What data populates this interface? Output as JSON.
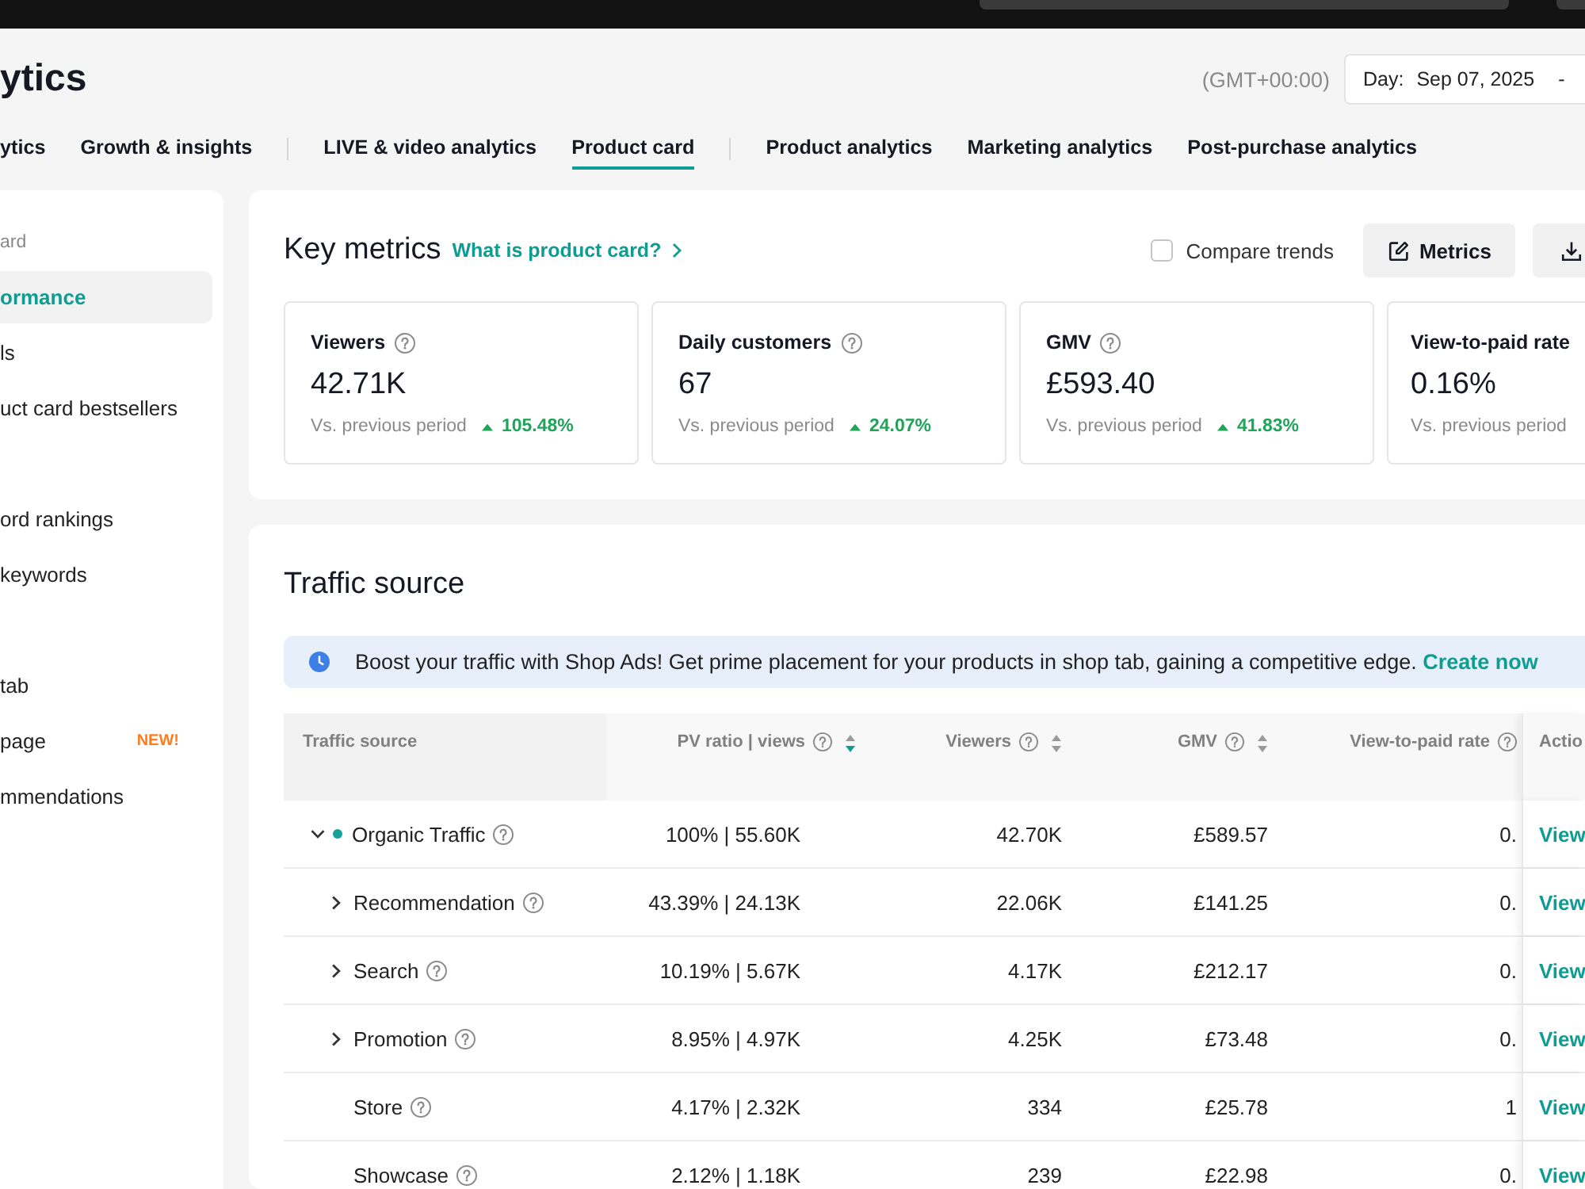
{
  "header": {
    "title": "ytics",
    "timezone": "(GMT+00:00)",
    "date_picker": {
      "label": "Day:",
      "value": "Sep 07, 2025",
      "separator": "-"
    }
  },
  "tab_groups": [
    {
      "tabs": [
        {
          "label": "ytics",
          "selected": false
        },
        {
          "label": "Growth & insights",
          "selected": false
        }
      ]
    },
    {
      "tabs": [
        {
          "label": "LIVE & video analytics",
          "selected": false
        },
        {
          "label": "Product card",
          "selected": true
        }
      ]
    },
    {
      "tabs": [
        {
          "label": "Product analytics",
          "selected": false
        },
        {
          "label": "Marketing analytics",
          "selected": false
        },
        {
          "label": "Post-purchase analytics",
          "selected": false
        }
      ]
    }
  ],
  "sidebar": {
    "groups": [
      {
        "heading": "ard",
        "items": [
          {
            "label": "ormance",
            "selected": true
          },
          {
            "label": "ls",
            "selected": false
          },
          {
            "label": "uct card bestsellers",
            "selected": false
          }
        ]
      },
      {
        "items": [
          {
            "label": "ord rankings",
            "selected": false
          },
          {
            "label": "keywords",
            "selected": false
          }
        ]
      },
      {
        "items": [
          {
            "label": "tab",
            "selected": false
          },
          {
            "label": "page",
            "selected": false,
            "badge": "NEW!"
          },
          {
            "label": "mmendations",
            "selected": false
          }
        ]
      }
    ]
  },
  "key_metrics": {
    "title": "Key metrics",
    "help_link": "What is product card?",
    "compare_trends": {
      "label": "Compare trends",
      "checked": false
    },
    "buttons": [
      {
        "kind": "edit",
        "label": "Metrics"
      },
      {
        "kind": "download"
      }
    ],
    "metrics": [
      {
        "label": "Viewers",
        "help": true,
        "value": "42.71K",
        "comparison": "Vs. previous period",
        "increase": true,
        "change": "105.48%"
      },
      {
        "label": "Daily customers",
        "help": true,
        "value": "67",
        "comparison": "Vs. previous period",
        "increase": true,
        "change": "24.07%"
      },
      {
        "label": "GMV",
        "help": true,
        "value": "£593.40",
        "comparison": "Vs. previous period",
        "increase": true,
        "change": "41.83%"
      },
      {
        "label": "View-to-paid rate",
        "help": false,
        "value": "0.16%",
        "comparison": "Vs. previous period"
      }
    ]
  },
  "traffic_source": {
    "title": "Traffic source",
    "banner": {
      "text": "Boost your traffic with Shop Ads! Get prime placement for your products in shop tab, gaining a competitive edge.",
      "link": "Create now"
    },
    "table": {
      "columns": [
        {
          "label": "Traffic source",
          "help": false
        },
        {
          "label": "PV ratio | views",
          "help": true,
          "sorted": true
        },
        {
          "label": "Viewers",
          "help": true,
          "sorted": false
        },
        {
          "label": "GMV",
          "help": true,
          "sorted": false
        },
        {
          "label": "View-to-paid rate",
          "help": true
        },
        {
          "label": "Actio",
          "help": false
        }
      ],
      "rows": [
        {
          "color": "#14a197",
          "expanded": true,
          "cells": [
            "Organic Traffic",
            "100% | 55.60K",
            "42.70K",
            "£589.57",
            "0.",
            "View"
          ],
          "children": [
            {
              "expanded": false,
              "cells": [
                "Recommendation",
                "43.39% | 24.13K",
                "22.06K",
                "£141.25",
                "0.",
                "View"
              ]
            },
            {
              "expanded": false,
              "cells": [
                "Search",
                "10.19% | 5.67K",
                "4.17K",
                "£212.17",
                "0.",
                "View"
              ]
            },
            {
              "expanded": false,
              "cells": [
                "Promotion",
                "8.95% | 4.97K",
                "4.25K",
                "£73.48",
                "0.",
                "View"
              ]
            },
            {
              "cells": [
                "Store",
                "4.17% | 2.32K",
                "334",
                "£25.78",
                "1",
                "View"
              ]
            },
            {
              "cells": [
                "Showcase",
                "2.12% | 1.18K",
                "239",
                "£22.98",
                "0.",
                "View"
              ]
            }
          ]
        }
      ]
    }
  }
}
